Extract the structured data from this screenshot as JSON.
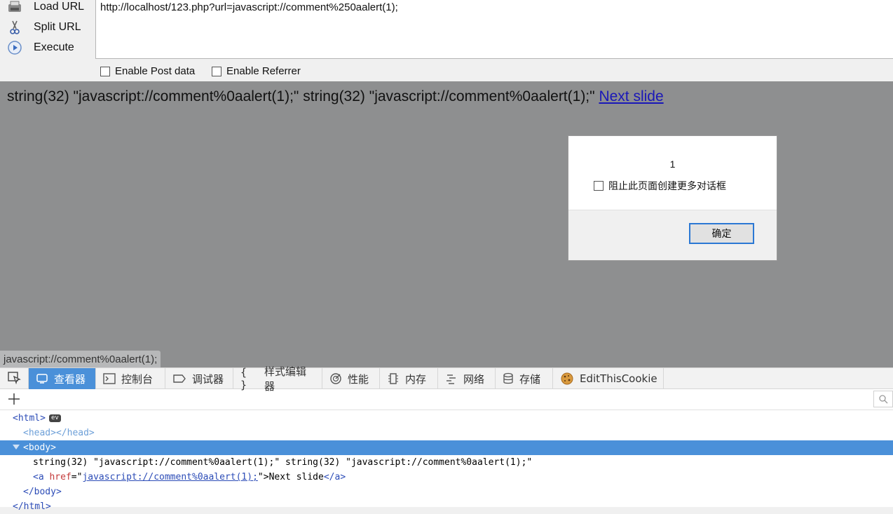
{
  "hackbar": {
    "load_url": "Load URL",
    "split_url": "Split URL",
    "execute": "Execute",
    "url_value": "http://localhost/123.php?url=javascript://comment%250aalert(1);",
    "enable_post": "Enable Post data",
    "enable_referrer": "Enable Referrer"
  },
  "page": {
    "output_text": "string(32) \"javascript://comment%0aalert(1);\" string(32) \"javascript://comment%0aalert(1);\"",
    "link_text": "Next slide",
    "status_url": "javascript://comment%0aalert(1);"
  },
  "alert": {
    "message": "1",
    "suppress_label": "阻止此页面创建更多对话框",
    "ok_label": "确定"
  },
  "devtools": {
    "tabs": [
      {
        "label": "查看器",
        "icon": "inspector-icon"
      },
      {
        "label": "控制台",
        "icon": "console-icon"
      },
      {
        "label": "调试器",
        "icon": "debugger-icon"
      },
      {
        "label": "样式编辑器",
        "icon": "style-editor-icon"
      },
      {
        "label": "性能",
        "icon": "performance-icon"
      },
      {
        "label": "内存",
        "icon": "memory-icon"
      },
      {
        "label": "网络",
        "icon": "network-icon"
      },
      {
        "label": "存储",
        "icon": "storage-icon"
      },
      {
        "label": "EditThisCookie",
        "icon": "cookie-icon"
      }
    ],
    "tree": {
      "html_open": "<html>",
      "ev_badge": "ev",
      "head": "<head></head>",
      "body_open": "<body>",
      "text_node": "string(32) \"javascript://comment%0aalert(1);\" string(32) \"javascript://comment%0aalert(1);\"",
      "a_open_prefix": "<a ",
      "a_attr": "href",
      "a_eq": "=\"",
      "a_href": "javascript://comment%0aalert(1);",
      "a_close_quote": "\">",
      "a_text": "Next slide",
      "a_close": "</a>",
      "body_close": "</body>",
      "html_close": "</html>"
    }
  }
}
